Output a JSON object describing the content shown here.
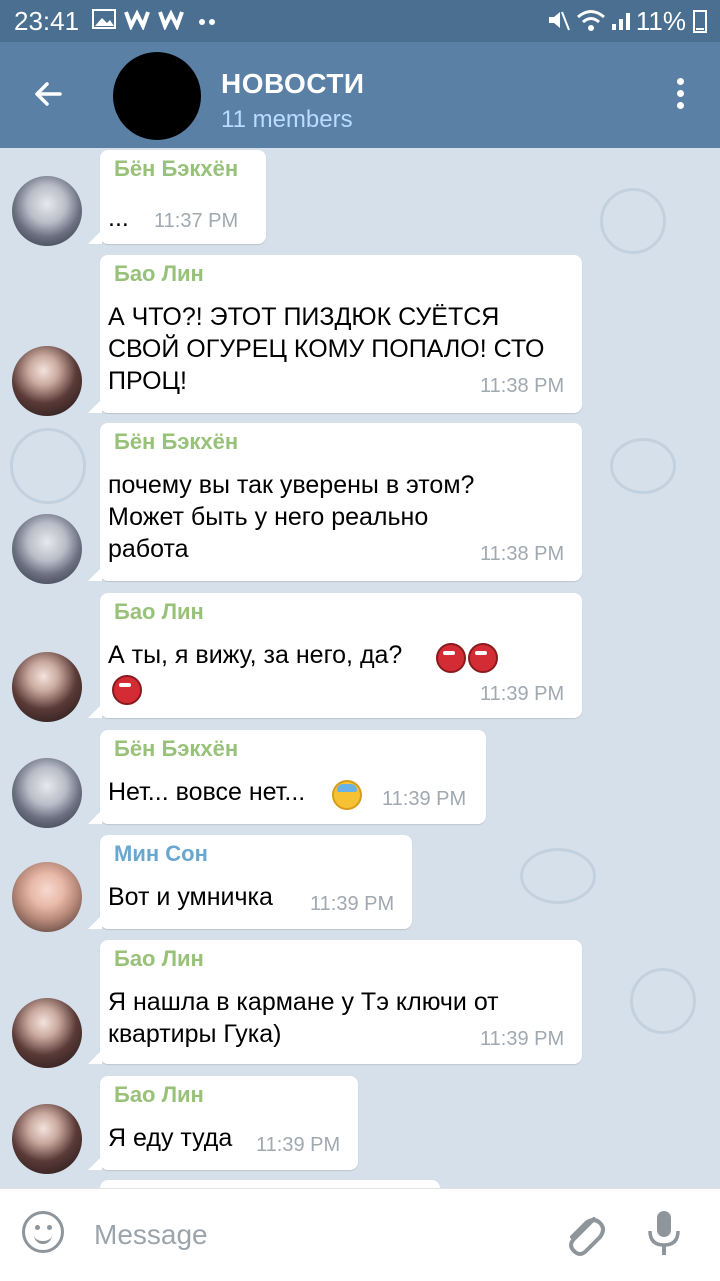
{
  "status_bar": {
    "time": "23:41",
    "icons": [
      "image-icon",
      "w-icon",
      "w-icon",
      "dots-icon"
    ],
    "right_icons": [
      "mute-icon",
      "wifi-icon",
      "signal-icon"
    ],
    "battery": "11%"
  },
  "header": {
    "title": "НОВОСТИ",
    "subtitle": "11 members"
  },
  "messages": [
    {
      "sender": "Бён Бэкхён",
      "text": "...",
      "time": "11:37 PM"
    },
    {
      "sender": "Бао Лин",
      "text_lines": [
        "А ЧТО?! ЭТОТ ПИЗДЮК СУЁТСЯ",
        "СВОЙ ОГУРЕЦ КОМУ ПОПАЛО! СТО",
        "ПРОЦ!"
      ],
      "time": "11:38 PM"
    },
    {
      "sender": "Бён Бэкхён",
      "text_lines": [
        "почему вы так уверены в этом?",
        "Может быть у него реально",
        "работа"
      ],
      "time": "11:38 PM"
    },
    {
      "sender": "Бао Лин",
      "text": "А ты, я вижу, за него, да?",
      "emojis": [
        "ogre-emoji",
        "ogre-emoji",
        "ogre-emoji"
      ],
      "time": "11:39 PM"
    },
    {
      "sender": "Бён Бэкхён",
      "text": "Нет... вовсе нет...",
      "emojis": [
        "anxious-face-emoji"
      ],
      "time": "11:39 PM"
    },
    {
      "sender": "Мин  Сон",
      "text": "Вот и умничка",
      "time": "11:39 PM"
    },
    {
      "sender": "Бао Лин",
      "text_lines": [
        "Я нашла в кармане у Тэ ключи от",
        "квартиры Гука)"
      ],
      "time": "11:39 PM"
    },
    {
      "sender": "Бао Лин",
      "text": "Я еду туда",
      "time": "11:39 PM"
    }
  ],
  "input": {
    "placeholder": "Message"
  },
  "colors": {
    "header": "#5b80a6",
    "status_bar": "#4a6f91",
    "chat_bg": "#d6e0ea",
    "sender_green": "#98c27a",
    "sender_blue": "#6aa7cf"
  }
}
